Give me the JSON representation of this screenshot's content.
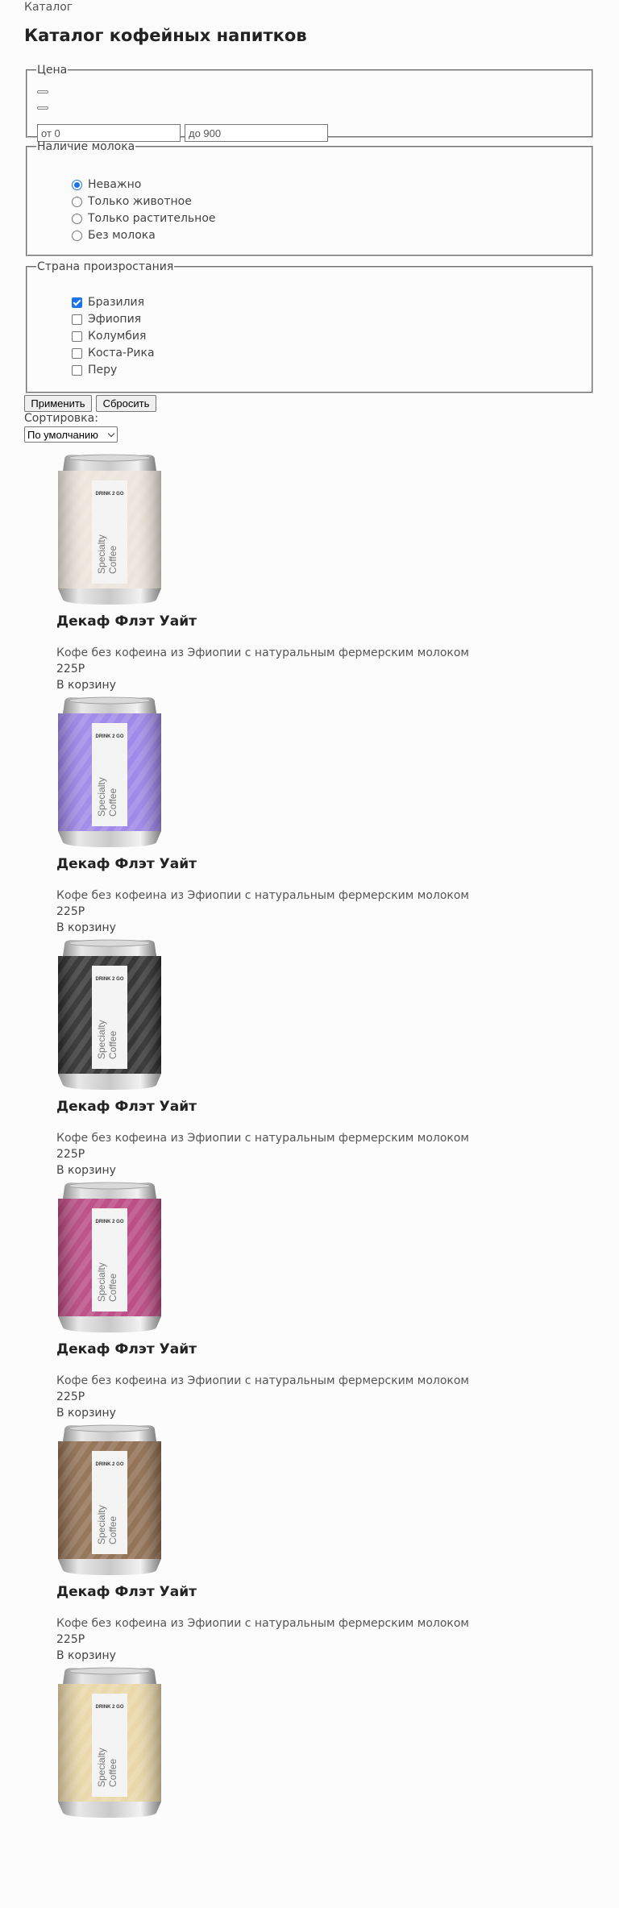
{
  "breadcrumb": "Каталог",
  "title": "Каталог кофейных напитков",
  "filters": {
    "price": {
      "legend": "Цена",
      "from_placeholder": "от 0",
      "to_placeholder": "до 900"
    },
    "milk": {
      "legend": "Наличие молока",
      "options": [
        {
          "label": "Неважно",
          "checked": true
        },
        {
          "label": "Только животное",
          "checked": false
        },
        {
          "label": "Только растительное",
          "checked": false
        },
        {
          "label": "Без молока",
          "checked": false
        }
      ]
    },
    "country": {
      "legend": "Страна произростания",
      "options": [
        {
          "label": "Бразилия",
          "checked": true
        },
        {
          "label": "Эфиопия",
          "checked": false
        },
        {
          "label": "Колумбия",
          "checked": false
        },
        {
          "label": "Коста-Рика",
          "checked": false
        },
        {
          "label": "Перу",
          "checked": false
        }
      ]
    }
  },
  "buttons": {
    "apply": "Применить",
    "reset": "Сбросить"
  },
  "sort": {
    "label": "Сортировка:",
    "selected": "По умолчанию"
  },
  "products": [
    {
      "title": "Декаф Флэт Уайт",
      "description": "Кофе без кофеина из Эфиопии с натуральным фермерским молоком",
      "price": "225Р",
      "cart_label": "В корзину",
      "can_color": "#ece4da",
      "brand": "DRINK 2 GO",
      "can_text_1": "Specialty",
      "can_text_2": "Coffee"
    },
    {
      "title": "Декаф Флэт Уайт",
      "description": "Кофе без кофеина из Эфиопии с натуральным фермерским молоком",
      "price": "225Р",
      "cart_label": "В корзину",
      "can_color": "#9b84e8",
      "brand": "DRINK 2 GO",
      "can_text_1": "Specialty",
      "can_text_2": "Coffee"
    },
    {
      "title": "Декаф Флэт Уайт",
      "description": "Кофе без кофеина из Эфиопии с натуральным фермерским молоком",
      "price": "225Р",
      "cart_label": "В корзину",
      "can_color": "#2c2c2c",
      "brand": "DRINK 2 GO",
      "can_text_1": "Specialty",
      "can_text_2": "Coffee"
    },
    {
      "title": "Декаф Флэт Уайт",
      "description": "Кофе без кофеина из Эфиопии с натуральным фермерским молоком",
      "price": "225Р",
      "cart_label": "В корзину",
      "can_color": "#b8457f",
      "brand": "DRINK 2 GO",
      "can_text_1": "Specialty",
      "can_text_2": "Coffee"
    },
    {
      "title": "Декаф Флэт Уайт",
      "description": "Кофе без кофеина из Эфиопии с натуральным фермерским молоком",
      "price": "225Р",
      "cart_label": "В корзину",
      "can_color": "#8e6c4d",
      "brand": "DRINK 2 GO",
      "can_text_1": "Specialty",
      "can_text_2": "Coffee"
    },
    {
      "title": "",
      "description": "",
      "price": "",
      "cart_label": "",
      "can_color": "#e9d6a6",
      "brand": "DRINK 2 GO",
      "can_text_1": "Specialty",
      "can_text_2": "Coffee"
    }
  ]
}
